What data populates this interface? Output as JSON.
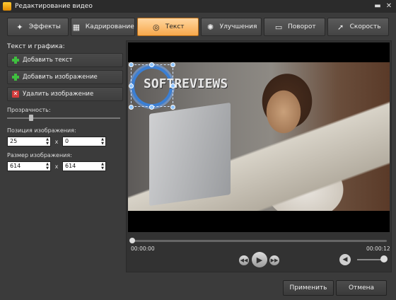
{
  "window": {
    "title": "Редактирование видео"
  },
  "tabs": [
    {
      "label": "Эффекты",
      "icon": "effects-icon"
    },
    {
      "label": "Кадрирование",
      "icon": "crop-icon"
    },
    {
      "label": "Текст",
      "icon": "text-icon",
      "active": true
    },
    {
      "label": "Улучшения",
      "icon": "enhance-icon"
    },
    {
      "label": "Поворот",
      "icon": "rotate-icon"
    },
    {
      "label": "Скорость",
      "icon": "speed-icon"
    }
  ],
  "left_panel": {
    "section_title": "Текст и графика:",
    "add_text": "Добавить текст",
    "add_image": "Добавить изображение",
    "delete_image": "Удалить изображение",
    "opacity_label": "Прозрачность:",
    "opacity_fraction": 0.2,
    "position_label": "Позиция изображения:",
    "position_x": "25",
    "position_y": "0",
    "size_label": "Размер изображения:",
    "size_w": "614",
    "size_h": "614",
    "x_sep": "x"
  },
  "preview": {
    "overlay_text": "SOFTREVIEWS",
    "time_start": "00:00:00",
    "time_end": "00:00:12"
  },
  "footer": {
    "apply": "Применить",
    "cancel": "Отмена"
  },
  "colors": {
    "accent_tab": "#f7a84b",
    "background": "#3b3b3b"
  }
}
